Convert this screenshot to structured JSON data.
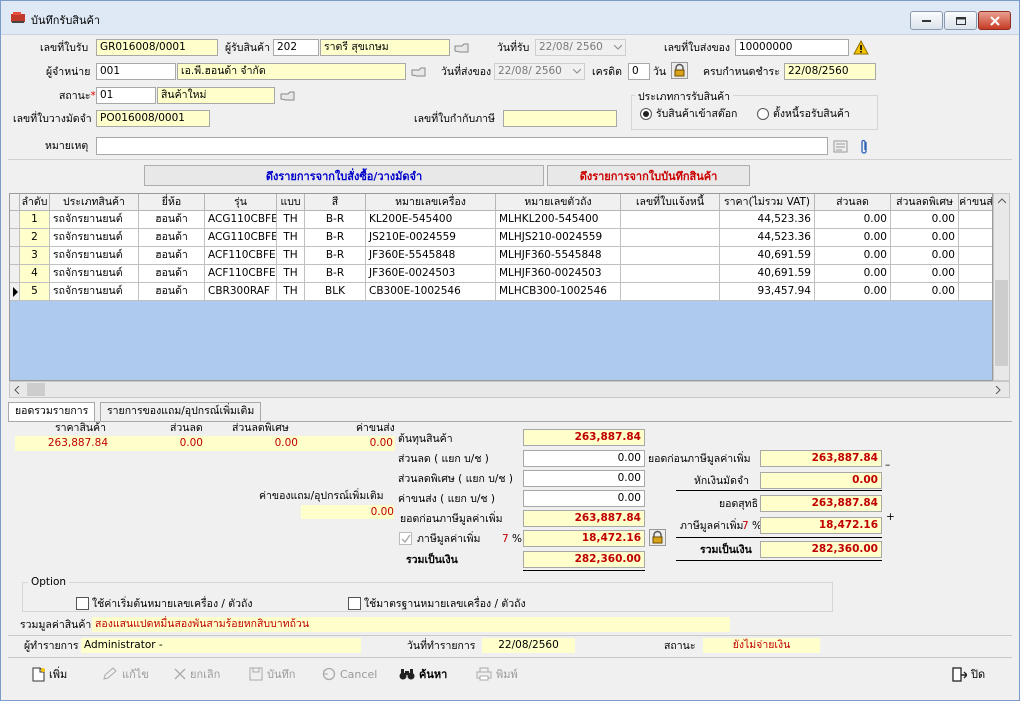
{
  "window": {
    "title": "บันทึกรับสินค้า"
  },
  "header": {
    "receipt_no_label": "เลขที่ใบรับ",
    "receipt_no": "GR016008/0001",
    "receiver_label": "ผู้รับสินค้า",
    "receiver_code": "202",
    "receiver_name": "ราตรี สุขเกษม",
    "receive_date_label": "วันที่รับ",
    "receive_date": "22/08/ 2560",
    "delivery_no_label": "เลขที่ใบส่งของ",
    "delivery_no": "10000000",
    "vendor_label": "ผู้จำหน่าย",
    "vendor_code": "001",
    "vendor_name": "เอ.พี.ฮอนด้า จำกัด",
    "ship_date_label": "วันที่ส่งของ",
    "ship_date": "22/08/ 2560",
    "credit_label": "เครดิต",
    "credit_days": "0",
    "days_unit": "วัน",
    "due_label": "ครบกำหนดชำระ",
    "due_date": "22/08/2560",
    "status_label": "สถานะ",
    "status_req": "*",
    "status_code": "01",
    "status_name": "สินค้าใหม่",
    "po_label": "เลขที่ใบวางมัดจำ",
    "po_no": "PO016008/0001",
    "tax_inv_label": "เลขที่ใบกำกับภาษี",
    "tax_inv_no": "",
    "note_label": "หมายเหตุ",
    "note": "",
    "receive_type": {
      "title": "ประเภทการรับสินค้า",
      "opt1": "รับสินค้าเข้าสต๊อก",
      "opt2": "ตั้งหนี้รอรับสินค้า",
      "selected": 1
    }
  },
  "buttons": {
    "pull_po": "ดึงรายการจากใบสั่งซื้อ/วางมัดจำ",
    "pull_receipt": "ดึงรายการจากใบบันทึกสินค้า"
  },
  "grid": {
    "columns": [
      "ลำดับ",
      "ประเภทสินค้า",
      "ยี่ห้อ",
      "รุ่น",
      "แบบ",
      "สี",
      "หมายเลขเครื่อง",
      "หมายเลขตัวถัง",
      "เลขที่ใบแจ้งหนี้",
      "ราคา(ไม่รวม VAT)",
      "ส่วนลด",
      "ส่วนลดพิเศษ",
      "ค่าขนส่ง"
    ],
    "rows": [
      [
        "1",
        "รถจักรยานยนต์",
        "ฮอนด้า",
        "ACG110CBFE",
        "TH",
        "B-R",
        "KL200E-545400",
        "MLHKL200-545400",
        "",
        "44,523.36",
        "0.00",
        "0.00"
      ],
      [
        "2",
        "รถจักรยานยนต์",
        "ฮอนด้า",
        "ACG110CBFE",
        "TH",
        "B-R",
        "JS210E-0024559",
        "MLHJS210-0024559",
        "",
        "44,523.36",
        "0.00",
        "0.00"
      ],
      [
        "3",
        "รถจักรยานยนต์",
        "ฮอนด้า",
        "ACF110CBFE",
        "TH",
        "B-R",
        "JF360E-5545848",
        "MLHJF360-5545848",
        "",
        "40,691.59",
        "0.00",
        "0.00"
      ],
      [
        "4",
        "รถจักรยานยนต์",
        "ฮอนด้า",
        "ACF110CBFE",
        "TH",
        "B-R",
        "JF360E-0024503",
        "MLHJF360-0024503",
        "",
        "40,691.59",
        "0.00",
        "0.00"
      ],
      [
        "5",
        "รถจักรยานยนต์",
        "ฮอนด้า",
        "CBR300RAF",
        "TH",
        "BLK",
        "CB300E-1002546",
        "MLHCB300-1002546",
        "",
        "93,457.94",
        "0.00",
        "0.00"
      ]
    ],
    "current_row": 4
  },
  "tabs": [
    "ยอดรวมรายการ",
    "รายการของแถม/อุปกรณ์เพิ่มเติม"
  ],
  "summary": {
    "col_price": "ราคาสินค้า",
    "col_disc": "ส่วนลด",
    "col_sdisc": "ส่วนลดพิเศษ",
    "col_ship": "ค่าขนส่ง",
    "val_price": "263,887.84",
    "val_disc": "0.00",
    "val_sdisc": "0.00",
    "val_ship": "0.00",
    "extras_label": "ค่าของแถม/อุปกรณ์เพิ่มเติม",
    "extras_val": "0.00",
    "cost_label": "ต้นทุนสินค้า",
    "cost": "263,887.84",
    "disc_label": "ส่วนลด ( แยก บ/ช )",
    "disc": "0.00",
    "sdisc_label": "ส่วนลดพิเศษ ( แยก บ/ช )",
    "sdisc": "0.00",
    "ship_label": "ค่าขนส่ง ( แยก บ/ช )",
    "ship": "0.00",
    "pre_vat_label": "ยอดก่อนภาษีมูลค่าเพิ่ม",
    "pre_vat": "263,887.84",
    "vat_label": "ภาษีมูลค่าเพิ่ม",
    "vat_rate": "7",
    "pct": "%",
    "vat": "18,472.16",
    "total_label": "รวมเป็นเงิน",
    "total": "282,360.00",
    "r_pre_vat_label": "ยอดก่อนภาษีมูลค่าเพิ่ม",
    "r_pre_vat": "263,887.84",
    "deposit_label": "หักเงินมัดจำ",
    "deposit": "0.00",
    "net_label": "ยอดสุทธิ",
    "net": "263,887.84",
    "r_vat_label": "ภาษีมูลค่าเพิ่ม",
    "r_vat_rate": "7",
    "r_pct": "%",
    "r_vat": "18,472.16",
    "r_total_label": "รวมเป็นเงิน",
    "r_total": "282,360.00",
    "minus": "–",
    "plus": "+"
  },
  "option": {
    "title": "Option",
    "opt1": "ใช้ค่าเริ่มต้นหมายเลขเครื่อง / ตัวถัง",
    "opt2": "ใช้มาตรฐานหมายเลขเครื่อง / ตัวถัง"
  },
  "amount_text_label": "รวมมูลค่าสินค้า",
  "amount_text": "สองแสนแปดหมื่นสองพันสามร้อยหกสิบบาทถ้วน",
  "footer": {
    "operator_label": "ผู้ทำรายการ",
    "operator": "Administrator -",
    "date_label": "วันที่ทำรายการ",
    "date": "22/08/2560",
    "status_label": "สถานะ",
    "status": "ยังไม่จ่ายเงิน"
  },
  "toolbar": {
    "add": "เพิ่ม",
    "edit": "แก้ไข",
    "cancel_doc": "ยกเลิก",
    "save": "บันทึก",
    "cancel": "Cancel",
    "search": "ค้นหา",
    "print": "พิมพ์",
    "close": "ปิด"
  }
}
